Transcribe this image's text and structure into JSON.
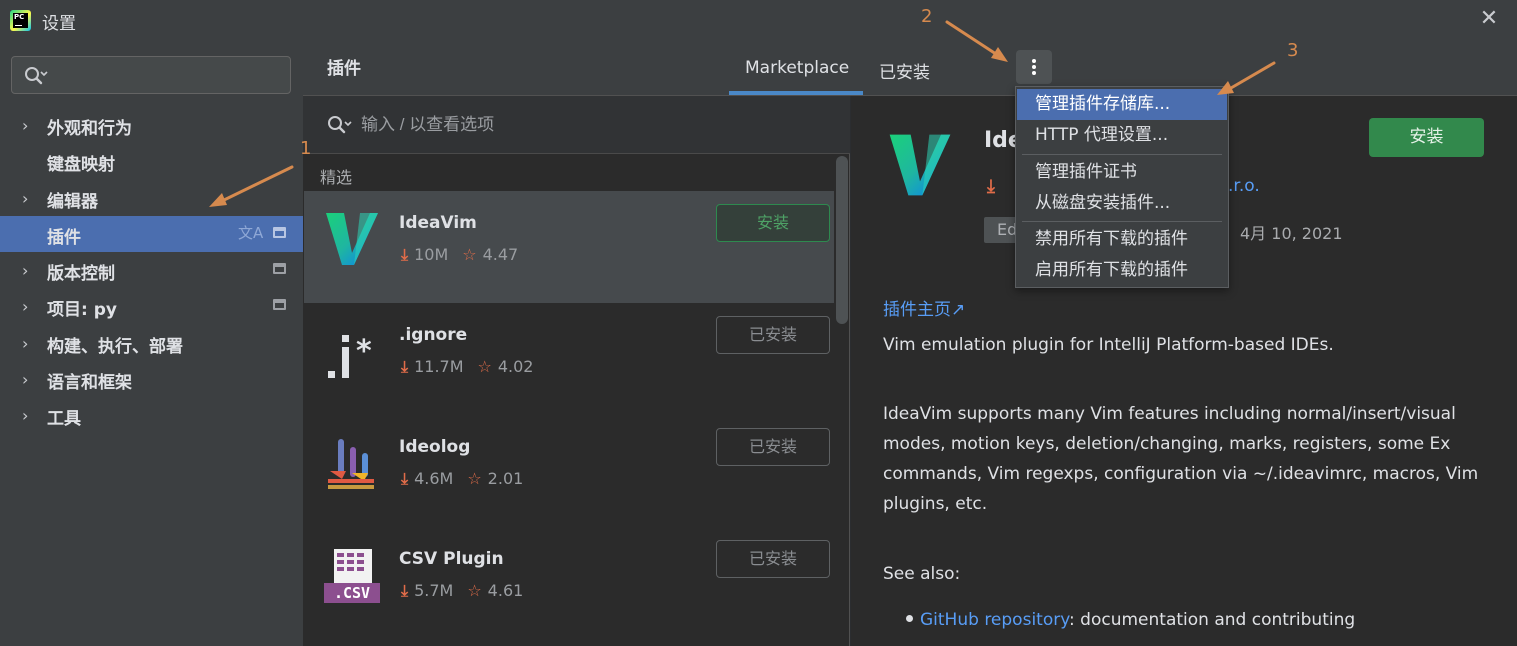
{
  "window": {
    "title": "设置",
    "close_glyph": "✕"
  },
  "sidebar": {
    "search_value": "",
    "items": [
      {
        "label": "外观和行为",
        "chevron": "›"
      },
      {
        "label": "键盘映射",
        "chevron": ""
      },
      {
        "label": "编辑器",
        "chevron": "›"
      },
      {
        "label": "插件",
        "chevron": "",
        "selected": true
      },
      {
        "label": "版本控制",
        "chevron": "›"
      },
      {
        "label": "项目: py",
        "chevron": "›"
      },
      {
        "label": "构建、执行、部署",
        "chevron": "›"
      },
      {
        "label": "语言和框架",
        "chevron": "›"
      },
      {
        "label": "工具",
        "chevron": "›"
      }
    ],
    "translate_glyph": "文A"
  },
  "main": {
    "title": "插件",
    "tabs": [
      {
        "label": "Marketplace",
        "active": true
      },
      {
        "label": "已安装",
        "active": false
      }
    ]
  },
  "plugin_list": {
    "search_placeholder": "输入 / 以查看选项",
    "section": "精选",
    "download_glyph": "⤓",
    "star_glyph": "☆",
    "plugins": [
      {
        "name": "IdeaVim",
        "downloads": "10M",
        "rating": "4.47",
        "action": "安装",
        "installed": false,
        "icon": "ideavim-logo"
      },
      {
        "name": ".ignore",
        "downloads": "11.7M",
        "rating": "4.02",
        "action": "已安装",
        "installed": true,
        "icon": "ignore-logo"
      },
      {
        "name": "Ideolog",
        "downloads": "4.6M",
        "rating": "2.01",
        "action": "已安装",
        "installed": true,
        "icon": "ideolog-logo"
      },
      {
        "name": "CSV Plugin",
        "downloads": "5.7M",
        "rating": "4.61",
        "action": "已安装",
        "installed": true,
        "icon": "csv-logo",
        "logo_text": ".CSV"
      }
    ]
  },
  "detail": {
    "name": "Ide",
    "vendor_fragment": ".r.o.",
    "tag": "Ed",
    "date": "4月 10, 2021",
    "install_label": "安装",
    "homepage_label": "插件主页",
    "homepage_glyph": "↗",
    "paragraphs": [
      "Vim emulation plugin for IntelliJ Platform-based IDEs.",
      "IdeaVim supports many Vim features including normal/insert/visual modes, motion keys, deletion/changing, marks, registers, some Ex commands, Vim regexps, configuration via ~/.ideavimrc, macros, Vim plugins, etc.",
      "See also:"
    ],
    "bullet_link": "GitHub repository",
    "bullet_rest": ": documentation and contributing"
  },
  "menu": {
    "items": [
      {
        "label": "管理插件存储库...",
        "highlighted": true
      },
      {
        "label": "HTTP 代理设置..."
      },
      {
        "label": "管理插件证书"
      },
      {
        "label": "从磁盘安装插件..."
      },
      {
        "label": "禁用所有下载的插件"
      },
      {
        "label": "启用所有下载的插件"
      }
    ]
  },
  "annotations": {
    "marker_1": "1",
    "marker_2": "2",
    "marker_3": "3",
    "color": "#d68a4e"
  },
  "colors": {
    "accent": "#4b6eaf",
    "install_green": "#32894c",
    "link": "#589df6",
    "download_orange": "#e06c49"
  }
}
